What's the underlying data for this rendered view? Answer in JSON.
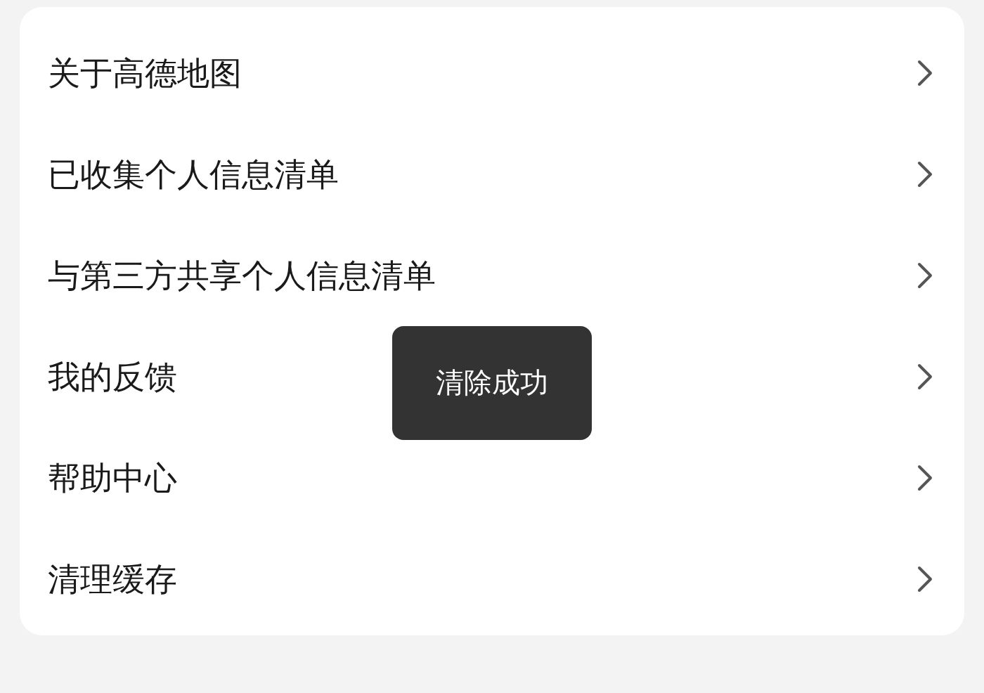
{
  "menu": {
    "items": [
      {
        "label": "关于高德地图"
      },
      {
        "label": "已收集个人信息清单"
      },
      {
        "label": "与第三方共享个人信息清单"
      },
      {
        "label": "我的反馈"
      },
      {
        "label": "帮助中心"
      },
      {
        "label": "清理缓存"
      }
    ]
  },
  "toast": {
    "message": "清除成功"
  }
}
